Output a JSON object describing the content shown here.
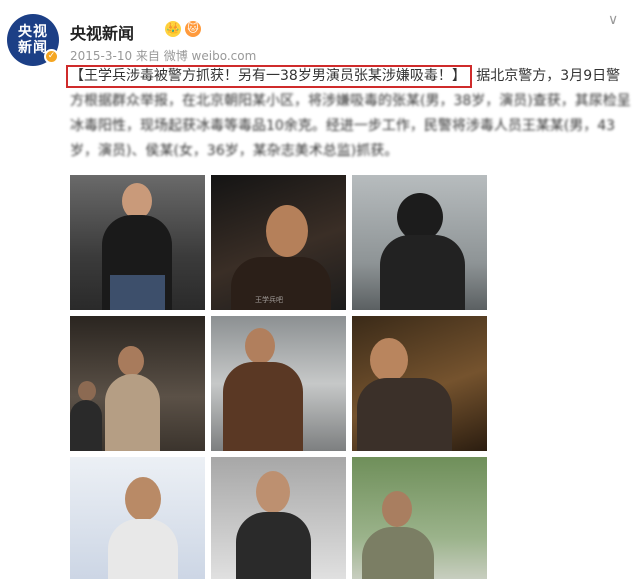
{
  "header": {
    "avatar_line1": "央视",
    "avatar_line2": "新闻",
    "account_name": "央视新闻",
    "badges": [
      "👑",
      "🐱"
    ],
    "meta": "2015-3-10 来自 微博 weibo.com",
    "verified_mark": "✓",
    "more_icon": "∨"
  },
  "post": {
    "headline": "【王学兵涉毒被警方抓获！另有一38岁男演员张某涉嫌吸毒！】",
    "body_line1_rest": "据北京警方，3月9日警",
    "body_rest": "方根据群众举报，在北京朝阳某小区，将涉嫌吸毒的张某(男，38岁，演员)查获，其尿检呈冰毒阳性，现场起获冰毒等毒品10余克。经进一步工作，民警将涉毒人员王某某(男，43岁，演员)、侯某(女，36岁，某杂志美术总监)抓获。"
  },
  "photos": {
    "watermark": "王学兵吧"
  },
  "colors": {
    "highlight_border": "#cf2b2b",
    "avatar_bg": "#1c3f86"
  }
}
